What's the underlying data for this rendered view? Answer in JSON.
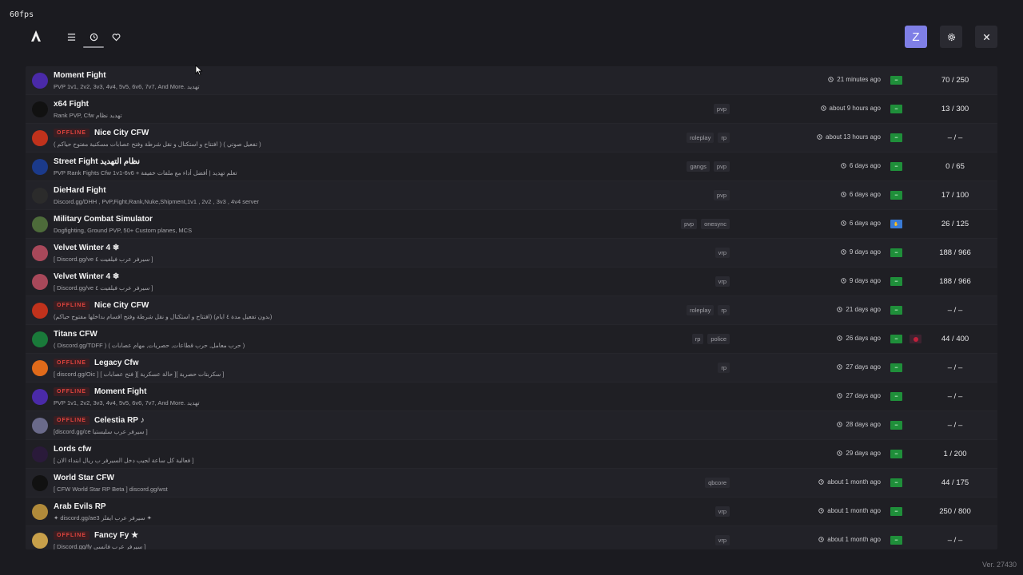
{
  "overlay": {
    "fps": "60fps",
    "version": "Ver. 27430"
  },
  "header": {
    "avatar_letter": "Z",
    "nav": [
      "list-icon",
      "history-icon",
      "heart-icon"
    ],
    "right_buttons": [
      "gear-icon",
      "close-icon"
    ]
  },
  "colors": {
    "accent": "#7f7fe6",
    "offline": "#e0443e",
    "background": "#1b1b20"
  },
  "servers": [
    {
      "offline": false,
      "name": "Moment Fight",
      "desc": "PVP 1v1, 2v2, 3v3, 4v4, 5v5, 6v6, 7v7, And More. تهديد",
      "tags": [],
      "time": "21 minutes ago",
      "flag": "sa",
      "players": "70 / 250",
      "icon_color": "#4a2aa8"
    },
    {
      "offline": false,
      "name": "x64 Fight",
      "desc": "Rank PVP, Cfw تهديد نظام",
      "tags": [
        "pvp"
      ],
      "time": "about 9 hours ago",
      "flag": "sa",
      "players": "13 / 300",
      "icon_color": "#111111"
    },
    {
      "offline": true,
      "offline_label": "OFFLINE",
      "name": "Nice City CFW",
      "desc": "( افتتاح و استكتال و نقل شرطة وفتح عصابات مسكنية مفتوح حياكم ) ( تفعيل صوتي )",
      "tags": [
        "roleplay",
        "rp"
      ],
      "time": "about 13 hours ago",
      "flag": "sa",
      "players": "– / –",
      "icon_color": "#c0321c"
    },
    {
      "offline": false,
      "name": "Street Fight نظام التهديد",
      "desc": "PVP Rank Fights Cfw 1v1-6v6 + تعلم تهديد | أفضل أداء مع ملفات خفيفة",
      "tags": [
        "gangs",
        "pvp"
      ],
      "time": "6 days ago",
      "flag": "sa",
      "players": "0 / 65",
      "icon_color": "#1b3a8a"
    },
    {
      "offline": false,
      "name": "DieHard Fight",
      "desc": "Discord.gg/DHH , PvP,Fight,Rank,Nuke,Shipment,1v1 , 2v2 , 3v3 , 4v4 server",
      "tags": [
        "pvp"
      ],
      "time": "6 days ago",
      "flag": "sa",
      "players": "17 / 100",
      "icon_color": "#2b2b2b"
    },
    {
      "offline": false,
      "name": "Military Combat Simulator",
      "desc": "Dogfighting, Ground PVP, 50+ Custom planes, MCS",
      "tags": [
        "pvp",
        "onesync"
      ],
      "time": "6 days ago",
      "flag": "blue",
      "players": "26 / 125",
      "icon_color": "#4d6b3a"
    },
    {
      "offline": false,
      "name": "Velvet Winter 4 ❄",
      "desc": "[ Discord.gg/ve سيرفر عرب فيلفيت ٤ ]",
      "tags": [
        "vrp"
      ],
      "time": "9 days ago",
      "flag": "sa",
      "players": "188 / 966",
      "icon_color": "#a8485a"
    },
    {
      "offline": false,
      "name": "Velvet Winter 4 ❄",
      "desc": "[ Discord.gg/ve سيرفر عرب فيلفيت ٤ ]",
      "tags": [
        "vrp"
      ],
      "time": "9 days ago",
      "flag": "sa",
      "players": "188 / 966",
      "icon_color": "#a8485a"
    },
    {
      "offline": true,
      "offline_label": "OFFLINE",
      "name": "Nice City CFW",
      "desc": "(افتتاح و استكتال و نقل شرطة وفتح اقسام بداخلها مفتوح حياكم) (بدون تفعيل مدة ٤ ايام)",
      "tags": [
        "roleplay",
        "rp"
      ],
      "time": "21 days ago",
      "flag": "sa",
      "players": "– / –",
      "icon_color": "#c0321c"
    },
    {
      "offline": false,
      "name": "Titans CFW",
      "desc": "( Discord.gg/TDFF ) ( حرب معامل, حرب قطاعات, حصريات, مهام عصابات )",
      "tags": [
        "rp",
        "police"
      ],
      "time": "26 days ago",
      "flag": "sa",
      "flag2": true,
      "players": "44 / 400",
      "icon_color": "#1a7a3a"
    },
    {
      "offline": true,
      "offline_label": "OFFLINE",
      "name": "Legacy Cfw",
      "desc": "[ discord.gg/Oic ] [ فتح عصابات ][ حالة عسكرية ][ سكربتات حصرية ]",
      "tags": [
        "rp"
      ],
      "time": "27 days ago",
      "flag": "sa",
      "players": "– / –",
      "icon_color": "#e06a1a"
    },
    {
      "offline": true,
      "offline_label": "OFFLINE",
      "name": "Moment Fight",
      "desc": "PVP 1v1, 2v2, 3v3, 4v4, 5v5, 6v6, 7v7, And More. تهديد",
      "tags": [],
      "time": "27 days ago",
      "flag": "sa",
      "players": "– / –",
      "icon_color": "#4a2aa8"
    },
    {
      "offline": true,
      "offline_label": "OFFLINE",
      "name": "Celestia RP ♪",
      "desc": "[discord.gg/ce سيرفر عرب سليستيا ]",
      "tags": [],
      "time": "28 days ago",
      "flag": "sa",
      "players": "– / –",
      "icon_color": "#6a6a8a"
    },
    {
      "offline": false,
      "name": "Lords cfw",
      "desc": "[ فعالية كل ساعة لجيب دخل السيرفر ب ريال ابتداء الان ]",
      "tags": [],
      "time": "29 days ago",
      "flag": "sa",
      "players": "1 / 200",
      "icon_color": "#2a1a3a"
    },
    {
      "offline": false,
      "name": "World Star CFW",
      "desc": "[ CFW World Star RP Beta ] discord.gg/wst",
      "tags": [
        "qbcore"
      ],
      "time": "about 1 month ago",
      "flag": "sa",
      "players": "44 / 175",
      "icon_color": "#111111"
    },
    {
      "offline": false,
      "name": "Arab Evils RP",
      "desc": "✦ discord.gg/ae3 سيرفر عرب ايفلز ✦",
      "tags": [
        "vrp"
      ],
      "time": "about 1 month ago",
      "flag": "sa",
      "players": "250 / 800",
      "icon_color": "#b08a3a"
    },
    {
      "offline": true,
      "offline_label": "OFFLINE",
      "name": "Fancy Fy ★",
      "desc": "[ Discord.gg/fy سيرفر عرب فانسي ]",
      "tags": [
        "vrp"
      ],
      "time": "about 1 month ago",
      "flag": "sa",
      "players": "– / –",
      "icon_color": "#c8a04a"
    }
  ]
}
